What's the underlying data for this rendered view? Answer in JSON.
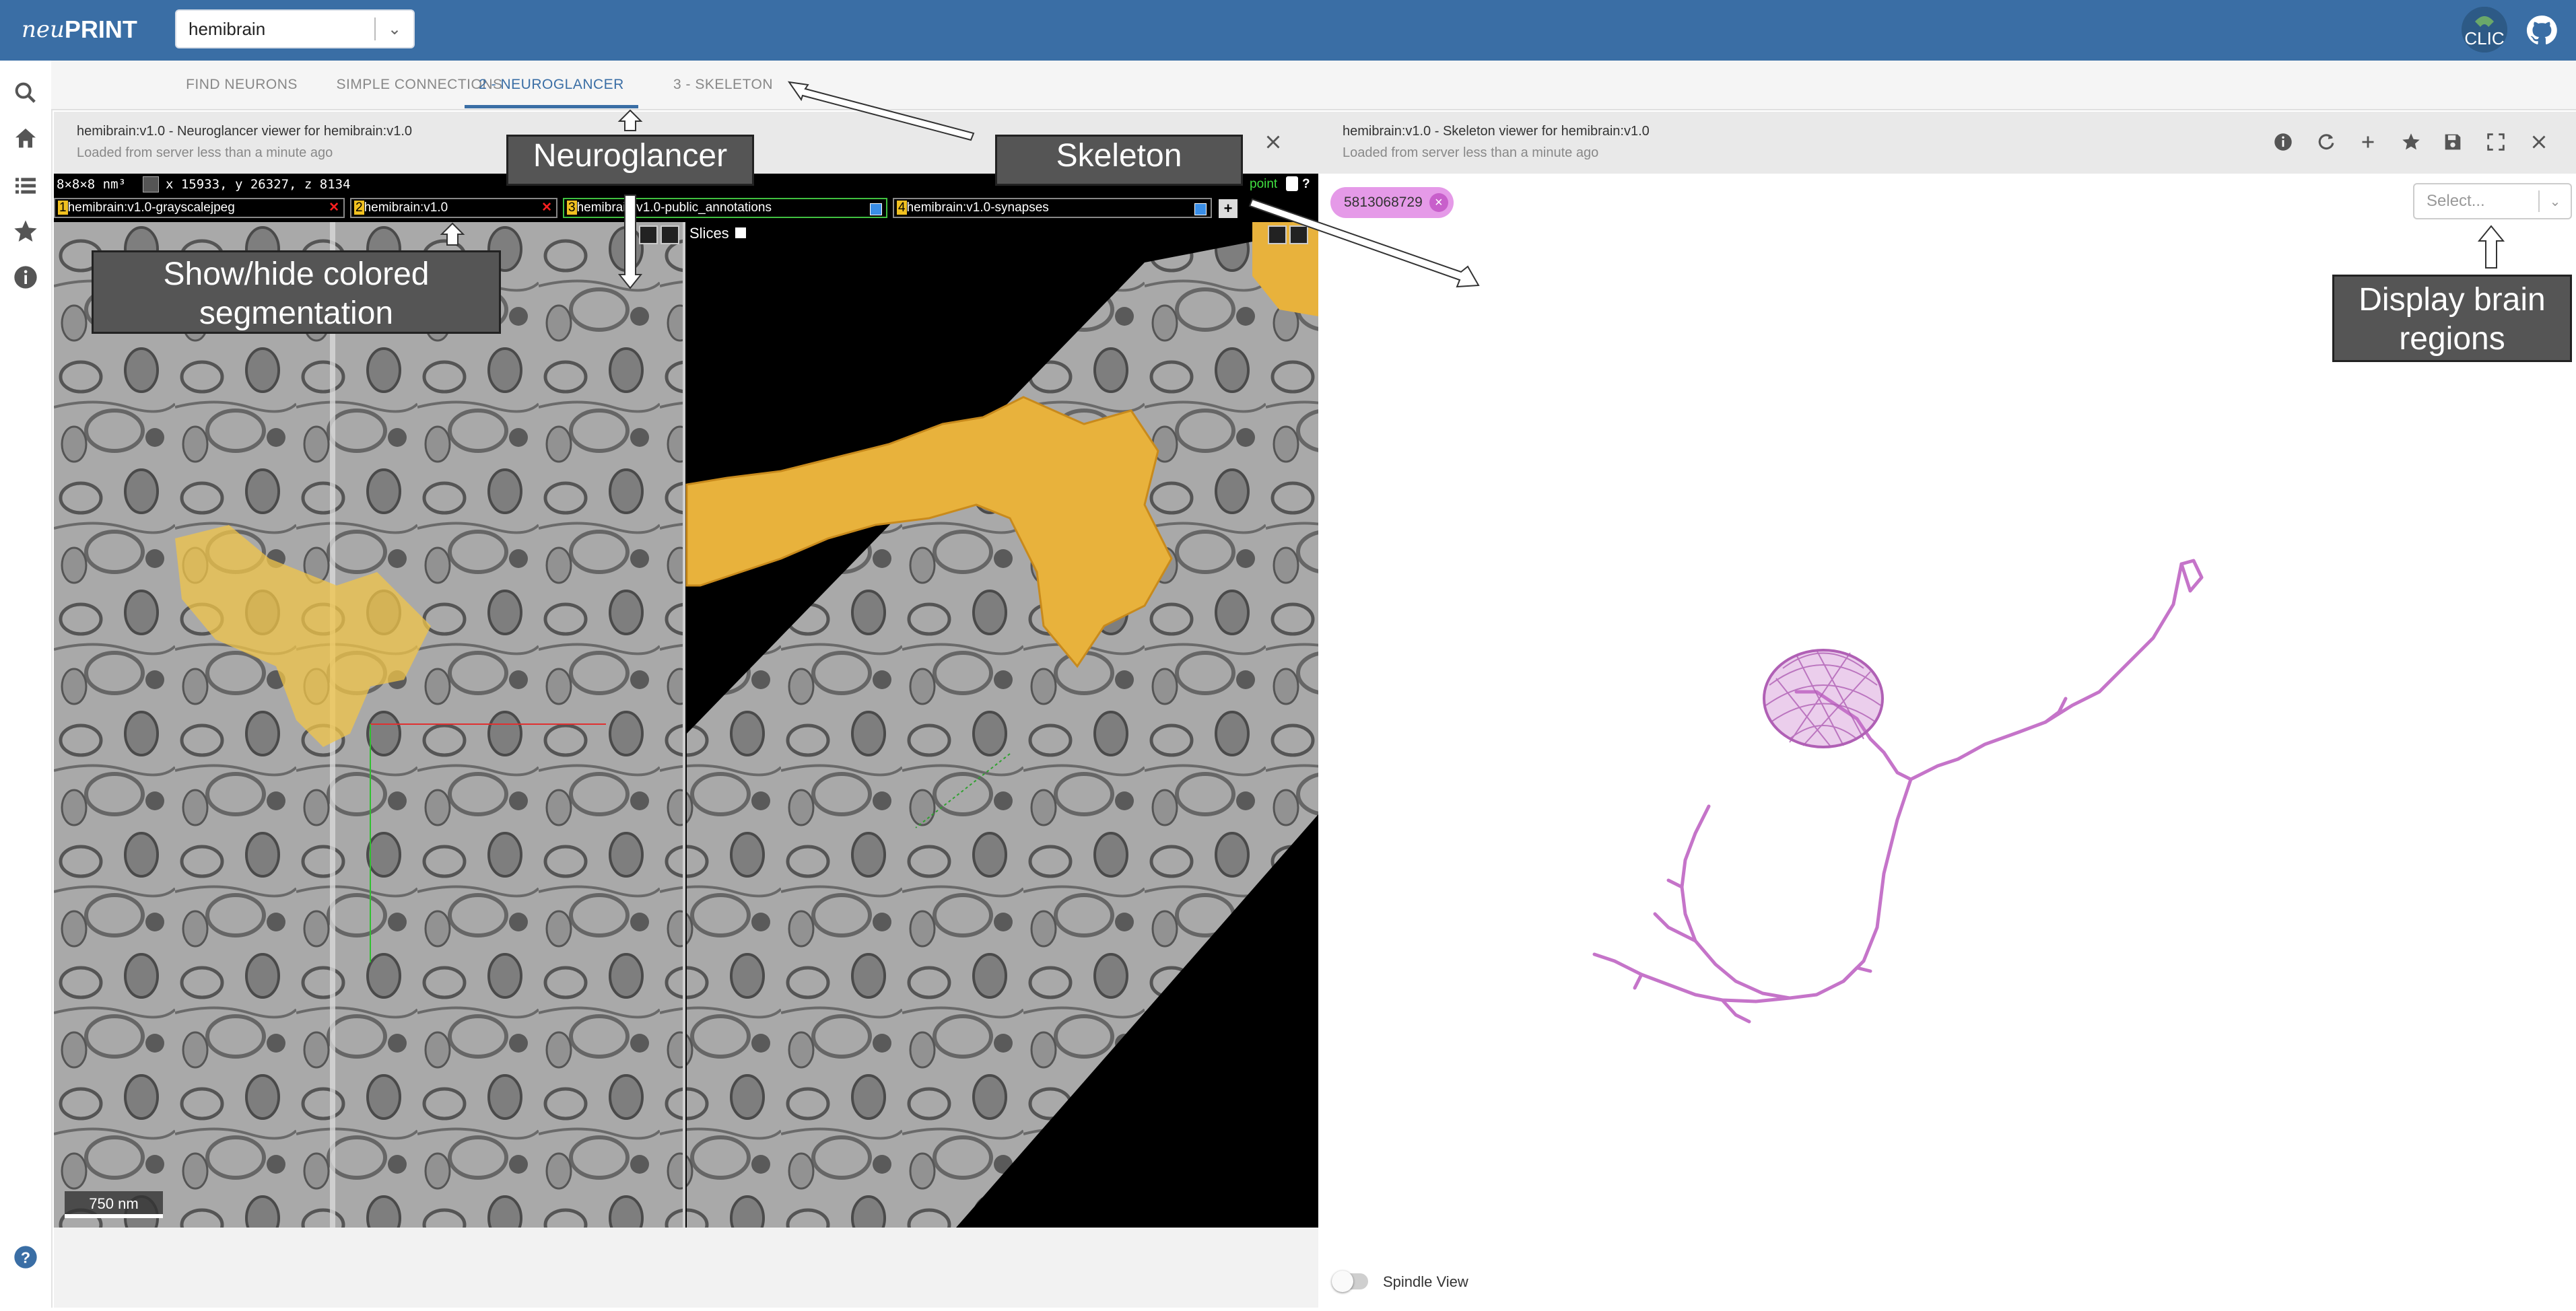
{
  "app": {
    "logo_neu": "neu",
    "logo_print": "PRINT",
    "dataset": "hemibrain",
    "avatar_text": "CLIC",
    "accent_color": "#3a6ea5"
  },
  "rail": {
    "icons": [
      "search-icon",
      "home-icon",
      "list-icon",
      "star-icon",
      "info-icon",
      "help-icon"
    ]
  },
  "tabs": [
    {
      "label": "FIND NEURONS",
      "active": false
    },
    {
      "label": "SIMPLE CONNECTIONS",
      "active": false
    },
    {
      "label": "2 - NEUROGLANCER",
      "active": true
    },
    {
      "label": "3 - SKELETON",
      "active": false
    }
  ],
  "neuroglancer_panel": {
    "title": "hemibrain:v1.0 - Neuroglancer viewer for hemibrain:v1.0",
    "subtitle": "Loaded from server less than a minute ago",
    "voxel_size": "8×8×8 nm³",
    "coordinates": "x 15933, y 26327, z 8134",
    "point_text": "point",
    "layers": [
      {
        "num": "1",
        "name": "hemibrain:v1.0-grayscalejpeg"
      },
      {
        "num": "2",
        "name": "hemibrain:v1.0"
      },
      {
        "num": "3",
        "name": "hemibrain:v1.0-public_annotations"
      },
      {
        "num": "4",
        "name": "hemibrain:v1.0-synapses"
      }
    ],
    "add_layer": "+",
    "slices_label": "Slices",
    "scale_bar": "750 nm"
  },
  "skeleton_panel": {
    "title": "hemibrain:v1.0 - Skeleton viewer for hemibrain:v1.0",
    "subtitle": "Loaded from server less than a minute ago",
    "neuron_id": "5813068729",
    "neuron_color": "#e59ae8",
    "region_placeholder": "Select...",
    "spindle_label": "Spindle View",
    "spindle_on": false
  },
  "callouts": {
    "neuroglancer": "Neuroglancer",
    "skeleton": "Skeleton",
    "segmentation_line1": "Show/hide colored",
    "segmentation_line2": "segmentation",
    "regions_line1": "Display brain",
    "regions_line2": "regions"
  }
}
